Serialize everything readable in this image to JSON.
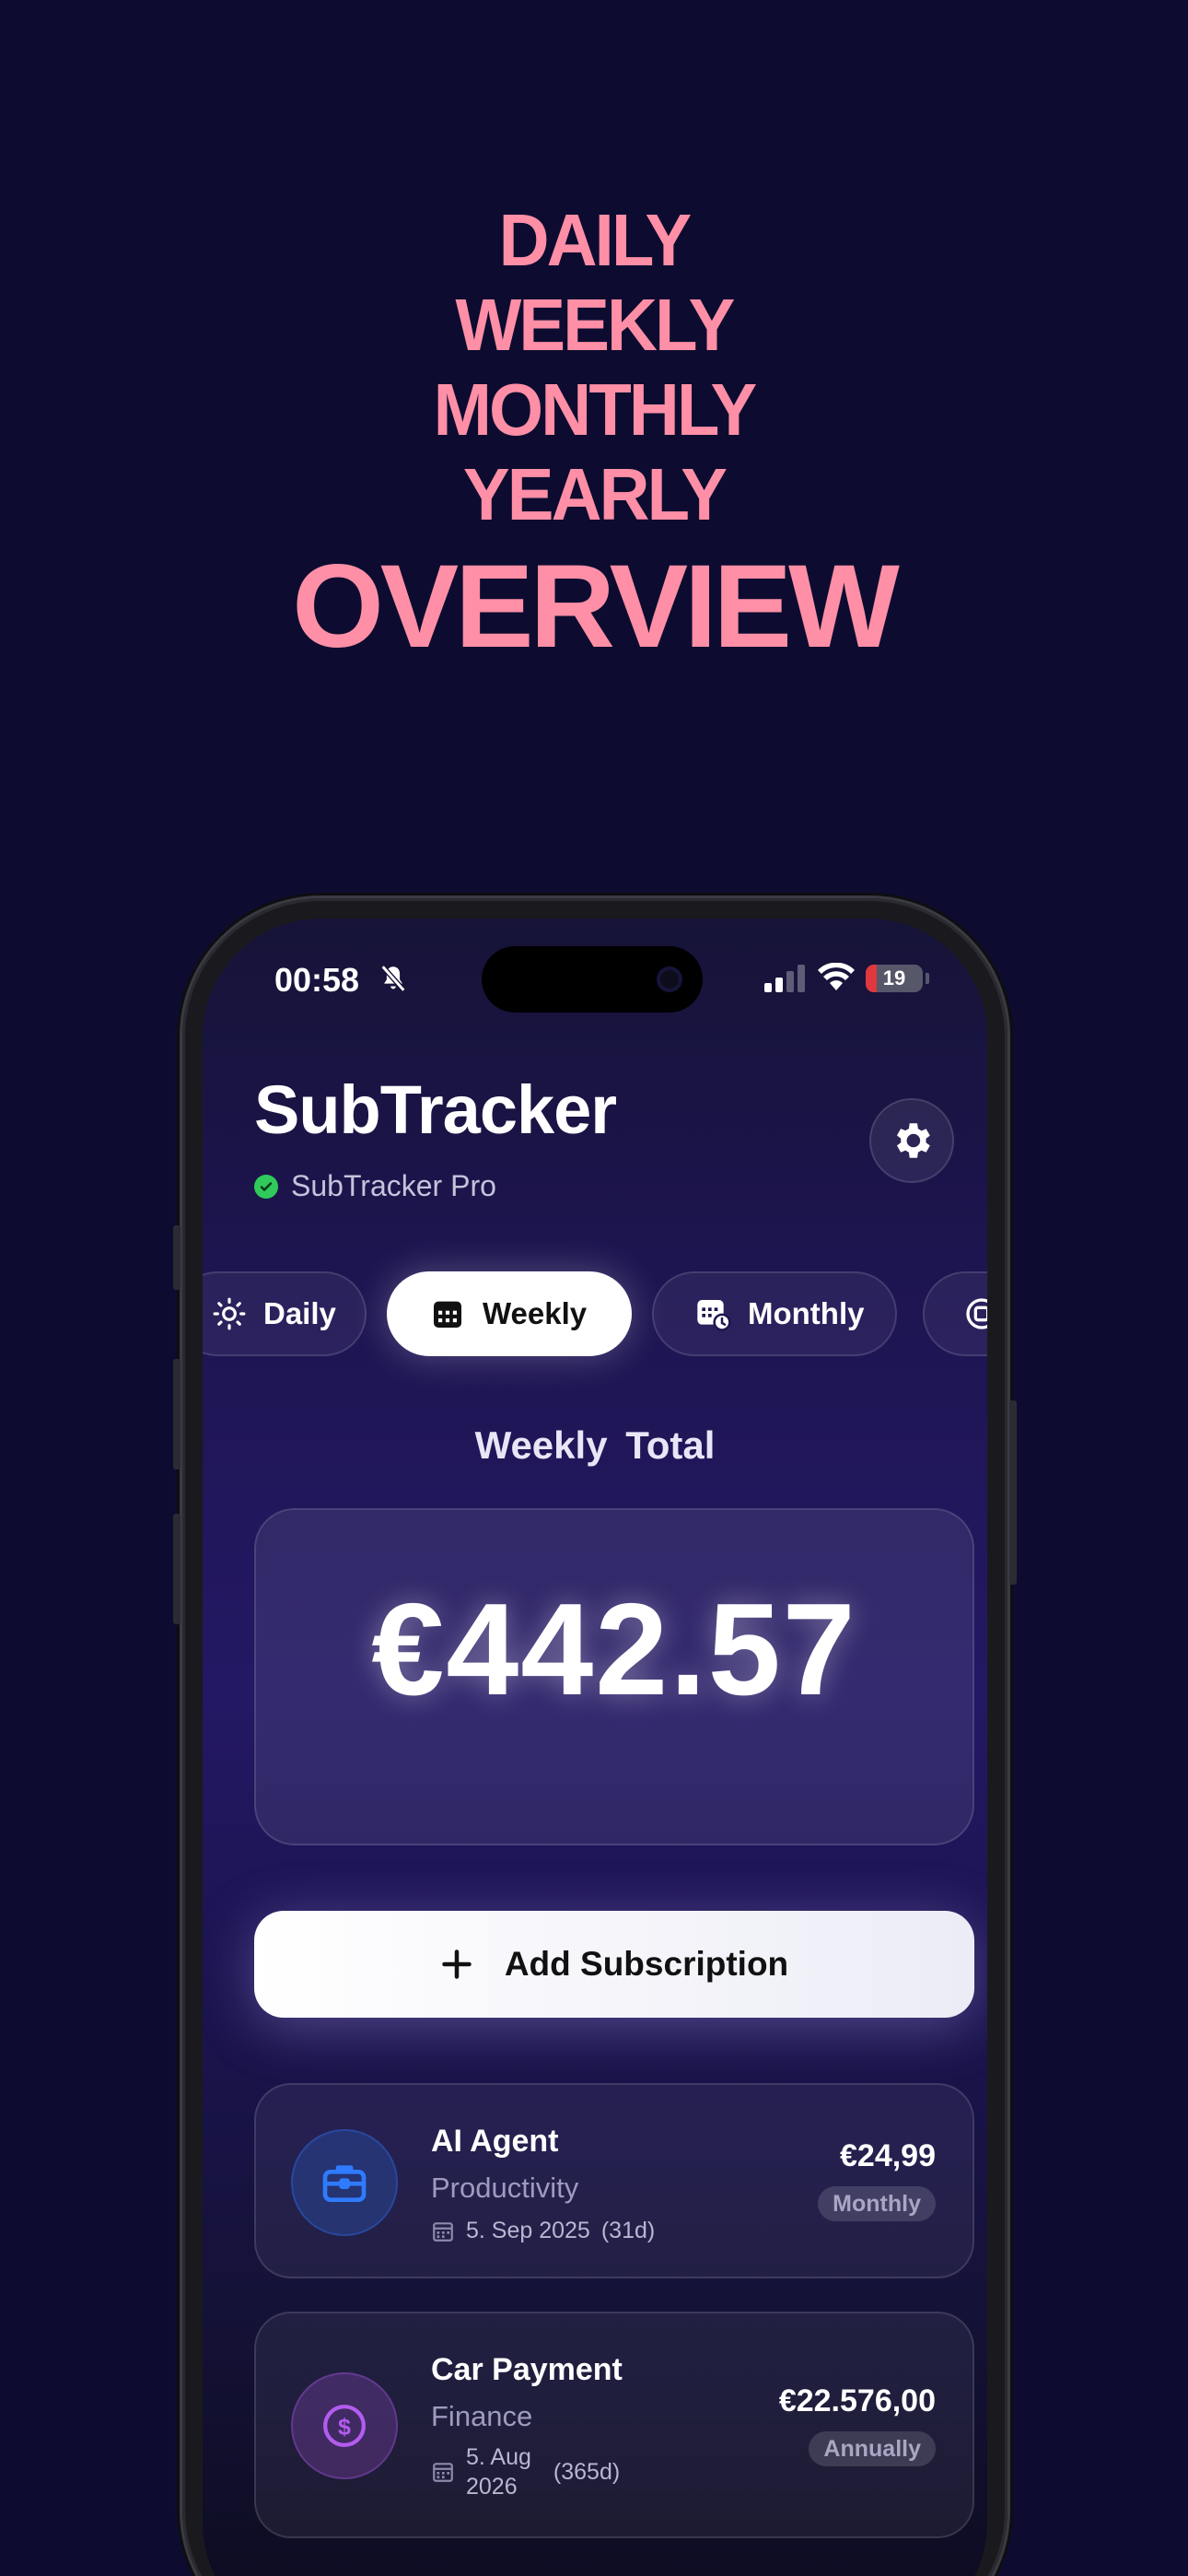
{
  "headline": {
    "lines": [
      "DAILY",
      "WEEKLY",
      "MONTHLY",
      "YEARLY"
    ],
    "big": "OVERVIEW",
    "color": "#ff8fa6"
  },
  "status_bar": {
    "time": "00:58",
    "battery": "19",
    "battery_level": 0.19
  },
  "app": {
    "title": "SubTracker",
    "pro_label": "SubTracker Pro"
  },
  "tabs": [
    {
      "label": "Daily",
      "icon": "sun-icon",
      "active": false
    },
    {
      "label": "Weekly",
      "icon": "calendar-icon",
      "active": true
    },
    {
      "label": "Monthly",
      "icon": "calendar-clock-icon",
      "active": false
    }
  ],
  "total": {
    "label": "Weekly  Total",
    "amount": "€442.57"
  },
  "add_button": {
    "label": "Add Subscription"
  },
  "subscriptions": [
    {
      "name": "AI Agent",
      "category": "Productivity",
      "date": "5. Sep 2025",
      "days": "(31d)",
      "price": "€24,99",
      "cycle": "Monthly",
      "icon": "briefcase-icon",
      "accent": "#2f7bff"
    },
    {
      "name": "Car Payment",
      "category": "Finance",
      "date_line1": "5. Aug",
      "date_line2": "2026",
      "days": "(365d)",
      "price": "€22.576,00",
      "cycle": "Annually",
      "icon": "dollar-coin-icon",
      "accent": "#b45cf0"
    }
  ],
  "colors": {
    "background": "#0d0c30",
    "pro_green": "#2fca5b"
  }
}
